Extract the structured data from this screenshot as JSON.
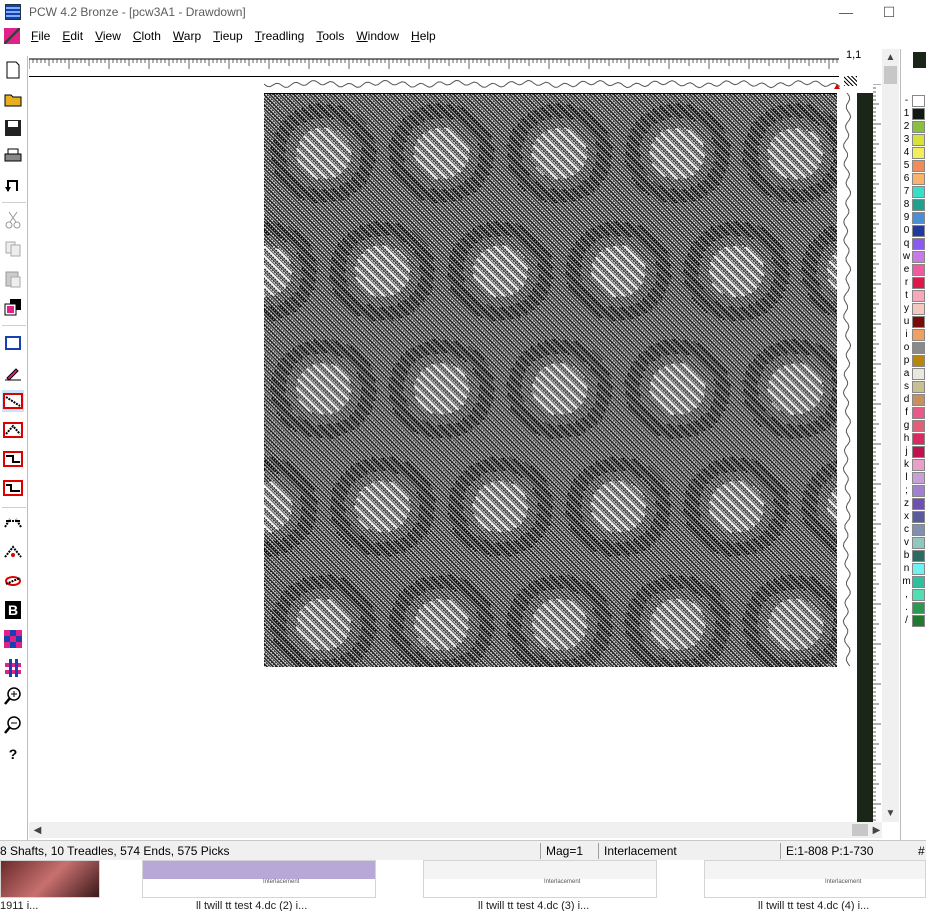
{
  "window": {
    "title": "PCW 4.2 Bronze - [pcw3A1 - Drawdown]",
    "minimize_glyph": "—",
    "maximize_glyph": "☐"
  },
  "menu": [
    "File",
    "Edit",
    "View",
    "Cloth",
    "Warp",
    "Tieup",
    "Treadling",
    "Tools",
    "Window",
    "Help"
  ],
  "ruler": {
    "position": "1,1"
  },
  "toolbar": {
    "icons": [
      "new-file-icon",
      "open-folder-icon",
      "save-icon",
      "print-icon",
      "undo-icon",
      "cut-icon",
      "copy-icon",
      "paste-icon",
      "color-swap-icon",
      "rectangle-select-icon",
      "eyedropper-icon",
      "straight-draw-icon",
      "point-draw-icon",
      "step-draw-icon",
      "step-draw-alt-icon",
      "mirror-horizontal-icon",
      "mirror-vertical-icon",
      "rotate-icon",
      "bold-b-icon",
      "color-grid-icon",
      "interlacement-icon",
      "zoom-in-icon",
      "zoom-out-icon",
      "help-pointer-icon"
    ],
    "bold_letter": "B",
    "help_glyph": "?"
  },
  "palette": {
    "keys": [
      "-",
      "1",
      "2",
      "3",
      "4",
      "5",
      "6",
      "7",
      "8",
      "9",
      "0",
      "q",
      "w",
      "e",
      "r",
      "t",
      "y",
      "u",
      "i",
      "o",
      "p",
      "a",
      "s",
      "d",
      "f",
      "g",
      "h",
      "j",
      "k",
      "l",
      ";",
      "z",
      "x",
      "c",
      "v",
      "b",
      "n",
      "m",
      ",",
      ".",
      "/"
    ],
    "colors": [
      "#ffffff",
      "#0e1a10",
      "#8bbf3f",
      "#d8e23a",
      "#f2ef5a",
      "#f28b5a",
      "#f9b36c",
      "#35e0c6",
      "#20a08f",
      "#4a8fd6",
      "#1f3a9a",
      "#8a5af0",
      "#c77ae6",
      "#f25aa0",
      "#e0184a",
      "#f7a8b8",
      "#f4c7c0",
      "#7a0a0a",
      "#f0a060",
      "#8a8a8a",
      "#b8860b",
      "#e8e8e0",
      "#c8c090",
      "#c89060",
      "#e85a8a",
      "#e0607a",
      "#d82a60",
      "#c01050",
      "#e8a0c8",
      "#c8a0d8",
      "#a080d0",
      "#7050b0",
      "#5a5aa0",
      "#8090b0",
      "#90c8c0",
      "#2a6a60",
      "#70f0f0",
      "#30c0a0",
      "#50e0b0",
      "#2a9a50",
      "#1f7a30"
    ]
  },
  "status": {
    "info": "8 Shafts, 10 Treadles, 574 Ends, 575 Picks",
    "mag": "Mag=1",
    "mode": "Interlacement",
    "range": "E:1-808  P:1-730",
    "hash": "#"
  },
  "taskbar": {
    "captions": [
      "1911 i...",
      "ll twill tt test 4.dc (2) i...",
      "ll twill tt test 4.dc (3) i...",
      "ll twill tt test 4.dc (4) i..."
    ],
    "thumb_labels": [
      "Interlacement",
      "Interlacement",
      "Interlacement"
    ]
  }
}
